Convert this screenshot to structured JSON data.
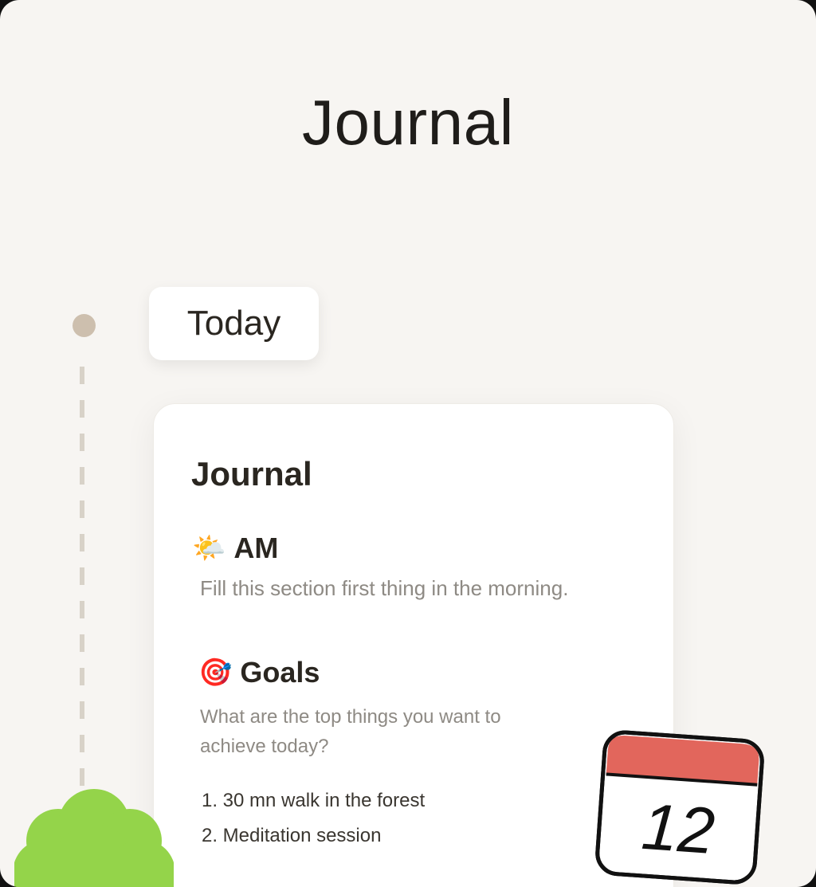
{
  "header": {
    "title": "Journal"
  },
  "timeline": {
    "today_label": "Today"
  },
  "card": {
    "title": "Journal",
    "am": {
      "emoji": "🌤️",
      "label": "AM",
      "description": "Fill this section first thing in the morning."
    },
    "goals": {
      "emoji": "🎯",
      "label": "Goals",
      "description": "What are the top things you want to achieve today?",
      "items": [
        "1. 30 mn walk in the forest",
        "2. Meditation session"
      ]
    }
  },
  "calendar": {
    "day": "12"
  },
  "colors": {
    "background": "#f7f5f2",
    "timeline_dot": "#cdbfae",
    "calendar_header": "#e2665c",
    "bush": "#94d44a"
  },
  "icons": {
    "am": "sun-behind-cloud-icon",
    "goals": "direct-hit-icon",
    "calendar": "calendar-icon",
    "bush": "bush-illustration"
  }
}
